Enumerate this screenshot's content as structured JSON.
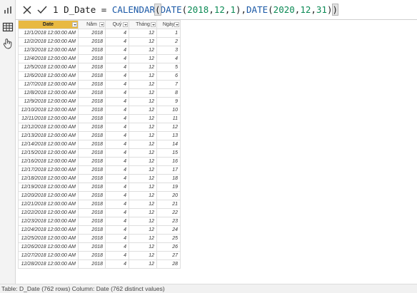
{
  "left_rail": {
    "top_icon": "report-view-icon",
    "items": [
      {
        "icon": "table-view-icon",
        "active": true
      },
      {
        "icon": "model-view-icon",
        "active": false
      }
    ]
  },
  "formula_bar": {
    "cancel_icon": "close-icon",
    "commit_icon": "checkmark-icon",
    "line_number": "1",
    "measure_name": "D_Date",
    "operator": "=",
    "fn_calendar": "CALENDAR",
    "fn_date": "DATE",
    "start": {
      "year": "2018",
      "month": "12",
      "day": "1"
    },
    "end": {
      "year": "2020",
      "month": "12",
      "day": "31"
    }
  },
  "table": {
    "columns": [
      "Date",
      "Năm",
      "Quý",
      "Tháng",
      "Ngày"
    ],
    "selected_column": "Date",
    "rows": [
      [
        "12/1/2018 12:00:00 AM",
        "2018",
        "4",
        "12",
        "1"
      ],
      [
        "12/2/2018 12:00:00 AM",
        "2018",
        "4",
        "12",
        "2"
      ],
      [
        "12/3/2018 12:00:00 AM",
        "2018",
        "4",
        "12",
        "3"
      ],
      [
        "12/4/2018 12:00:00 AM",
        "2018",
        "4",
        "12",
        "4"
      ],
      [
        "12/5/2018 12:00:00 AM",
        "2018",
        "4",
        "12",
        "5"
      ],
      [
        "12/6/2018 12:00:00 AM",
        "2018",
        "4",
        "12",
        "6"
      ],
      [
        "12/7/2018 12:00:00 AM",
        "2018",
        "4",
        "12",
        "7"
      ],
      [
        "12/8/2018 12:00:00 AM",
        "2018",
        "4",
        "12",
        "8"
      ],
      [
        "12/9/2018 12:00:00 AM",
        "2018",
        "4",
        "12",
        "9"
      ],
      [
        "12/10/2018 12:00:00 AM",
        "2018",
        "4",
        "12",
        "10"
      ],
      [
        "12/11/2018 12:00:00 AM",
        "2018",
        "4",
        "12",
        "11"
      ],
      [
        "12/12/2018 12:00:00 AM",
        "2018",
        "4",
        "12",
        "12"
      ],
      [
        "12/13/2018 12:00:00 AM",
        "2018",
        "4",
        "12",
        "13"
      ],
      [
        "12/14/2018 12:00:00 AM",
        "2018",
        "4",
        "12",
        "14"
      ],
      [
        "12/15/2018 12:00:00 AM",
        "2018",
        "4",
        "12",
        "15"
      ],
      [
        "12/16/2018 12:00:00 AM",
        "2018",
        "4",
        "12",
        "16"
      ],
      [
        "12/17/2018 12:00:00 AM",
        "2018",
        "4",
        "12",
        "17"
      ],
      [
        "12/18/2018 12:00:00 AM",
        "2018",
        "4",
        "12",
        "18"
      ],
      [
        "12/19/2018 12:00:00 AM",
        "2018",
        "4",
        "12",
        "19"
      ],
      [
        "12/20/2018 12:00:00 AM",
        "2018",
        "4",
        "12",
        "20"
      ],
      [
        "12/21/2018 12:00:00 AM",
        "2018",
        "4",
        "12",
        "21"
      ],
      [
        "12/22/2018 12:00:00 AM",
        "2018",
        "4",
        "12",
        "22"
      ],
      [
        "12/23/2018 12:00:00 AM",
        "2018",
        "4",
        "12",
        "23"
      ],
      [
        "12/24/2018 12:00:00 AM",
        "2018",
        "4",
        "12",
        "24"
      ],
      [
        "12/25/2018 12:00:00 AM",
        "2018",
        "4",
        "12",
        "25"
      ],
      [
        "12/26/2018 12:00:00 AM",
        "2018",
        "4",
        "12",
        "26"
      ],
      [
        "12/27/2018 12:00:00 AM",
        "2018",
        "4",
        "12",
        "27"
      ],
      [
        "12/28/2018 12:00:00 AM",
        "2018",
        "4",
        "12",
        "28"
      ]
    ]
  },
  "status_bar": {
    "text": "Table: D_Date (762 rows) Column: Date (762 distinct values)"
  },
  "colors": {
    "selected_header": "#e8b941",
    "function_blue": "#1a58a6",
    "number_green": "#0c8a55"
  }
}
